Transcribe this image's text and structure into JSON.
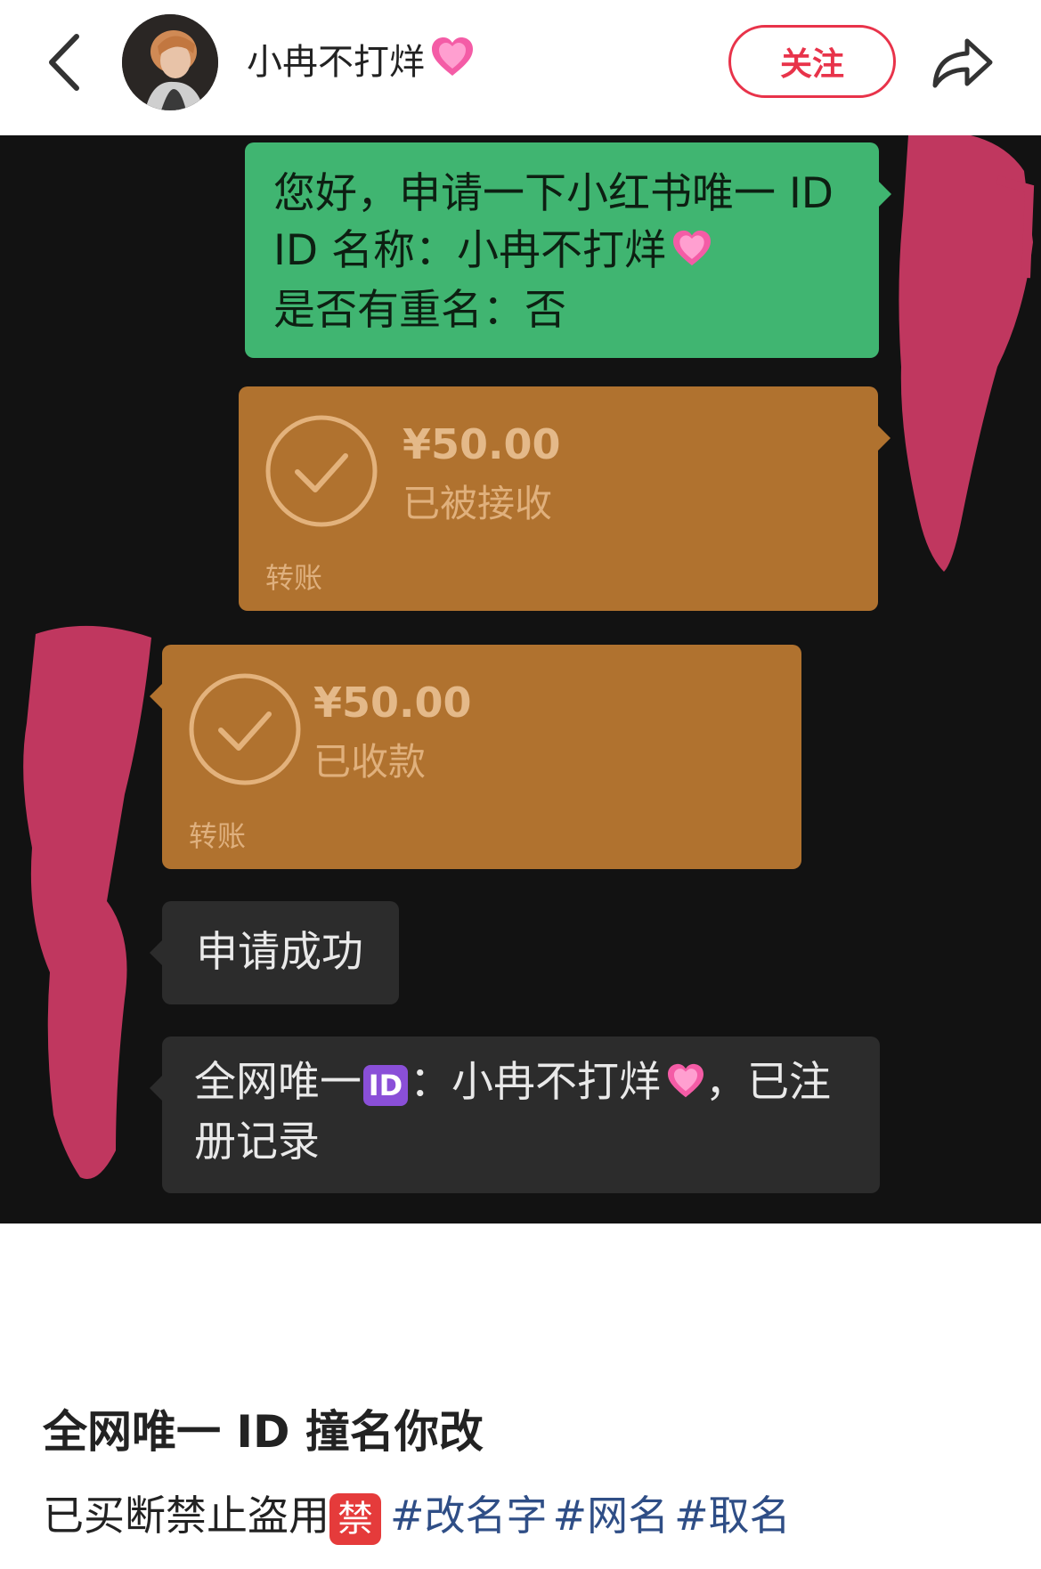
{
  "header": {
    "author_name": "小冉不打烊",
    "follow_label": "关注"
  },
  "chat": {
    "outgoing_message": {
      "lines": [
        "您好，申请一下小红书唯一 ID",
        "ID 名称：小冉不打烊",
        "是否有重名：否"
      ]
    },
    "transfer_sent": {
      "amount": "¥50.00",
      "status": "已被接收",
      "label": "转账"
    },
    "transfer_received": {
      "amount": "¥50.00",
      "status": "已收款",
      "label": "转账"
    },
    "reply_1": "申请成功",
    "reply_2": {
      "prefix": "全网唯一",
      "badge": "ID",
      "middle": "：小冉不打烊",
      "suffix": "，已注",
      "line2": "册记录"
    },
    "colors": {
      "background": "#121212",
      "outgoing_bubble": "#40b571",
      "transfer_bubble": "#b0722f",
      "incoming_bubble": "#2c2c2c",
      "redaction": "#c0375f"
    }
  },
  "post": {
    "title": "全网唯一 ID 撞名你改",
    "body_text": "已买断禁止盗用",
    "badge": "禁",
    "tags": [
      "#改名字",
      "#网名",
      "#取名"
    ]
  },
  "icons": {
    "back": "chevron-left-icon",
    "share": "share-arrow-icon",
    "check": "check-circle-icon",
    "voice": "voice-icon",
    "mic": "microphone-icon",
    "emoji": "smiley-icon",
    "plus": "plus-circle-icon",
    "heart": "pink-heart-emoji"
  }
}
